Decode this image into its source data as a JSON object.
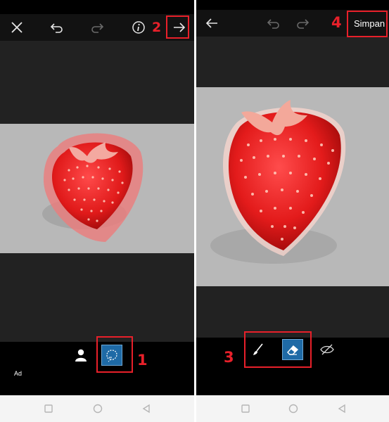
{
  "left": {
    "ad_label": "Ad",
    "step_1": "1",
    "step_2": "2"
  },
  "right": {
    "save_label": "Simpan",
    "step_3": "3",
    "step_4": "4"
  },
  "colors": {
    "accent": "#e8202a",
    "active_tool": "#1e6aa6",
    "topbar": "#121212",
    "canvas": "#222222",
    "photo_bg": "#b8b8b8"
  },
  "icons": {
    "left_topbar": [
      "close-icon",
      "undo-icon",
      "redo-icon",
      "info-icon",
      "arrow-right-icon"
    ],
    "left_tools": [
      "person-icon",
      "lasso-icon"
    ],
    "right_topbar": [
      "arrow-left-icon",
      "undo-icon",
      "redo-icon"
    ],
    "right_tools": [
      "brush-icon",
      "eraser-icon",
      "eye-off-icon"
    ],
    "navbar": [
      "square-icon",
      "circle-icon",
      "triangle-back-icon"
    ]
  }
}
